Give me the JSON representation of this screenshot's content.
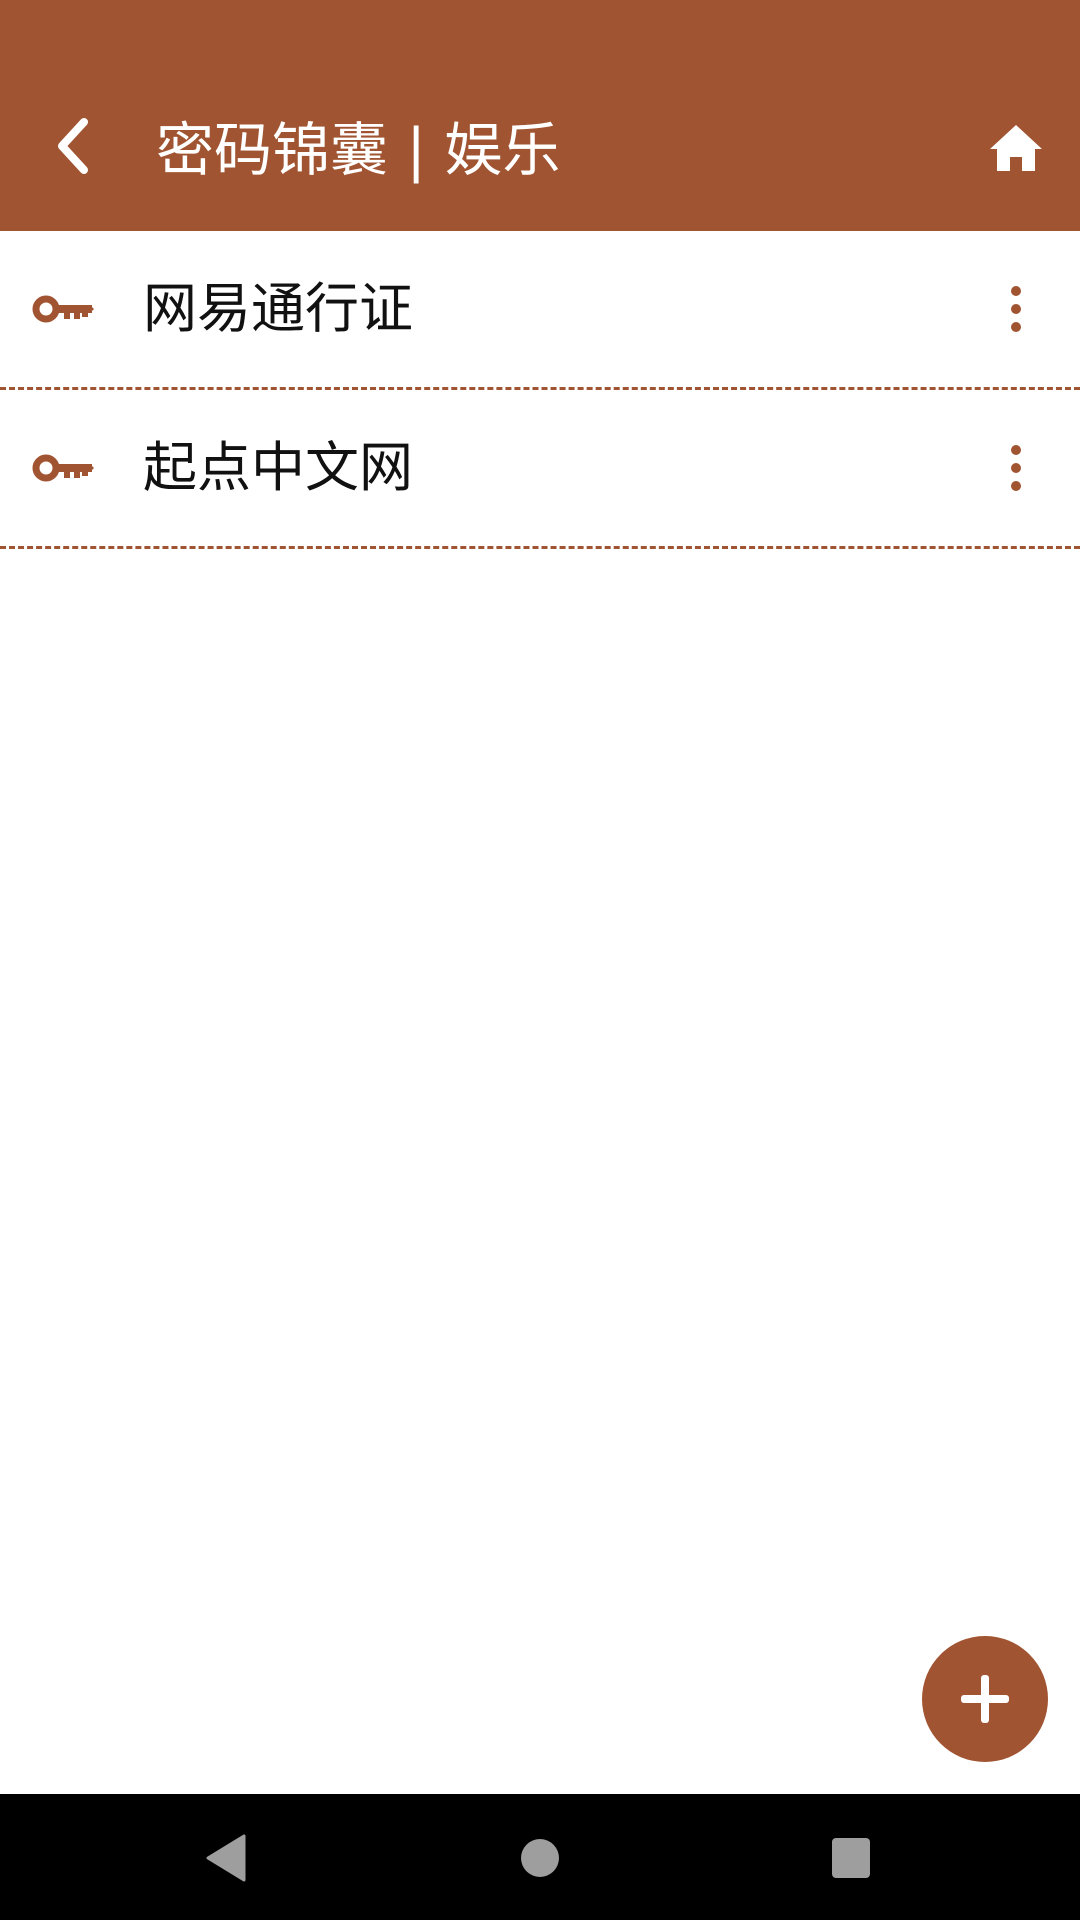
{
  "colors": {
    "primary": "#A15431",
    "background": "#ffffff",
    "text": "#111111",
    "nav_bar": "#000000",
    "nav_icons": "#9E9E9E"
  },
  "header": {
    "title": "密码锦囊 | 娱乐",
    "back_icon": "chevron-left-icon",
    "home_icon": "home-icon"
  },
  "list": {
    "items": [
      {
        "label": "网易通行证",
        "icon": "key-icon",
        "menu_icon": "more-vertical-icon"
      },
      {
        "label": "起点中文网",
        "icon": "key-icon",
        "menu_icon": "more-vertical-icon"
      }
    ]
  },
  "fab": {
    "icon": "plus-icon"
  },
  "system_nav": {
    "back_icon": "triangle-back-icon",
    "home_icon": "circle-home-icon",
    "recents_icon": "square-recents-icon"
  }
}
